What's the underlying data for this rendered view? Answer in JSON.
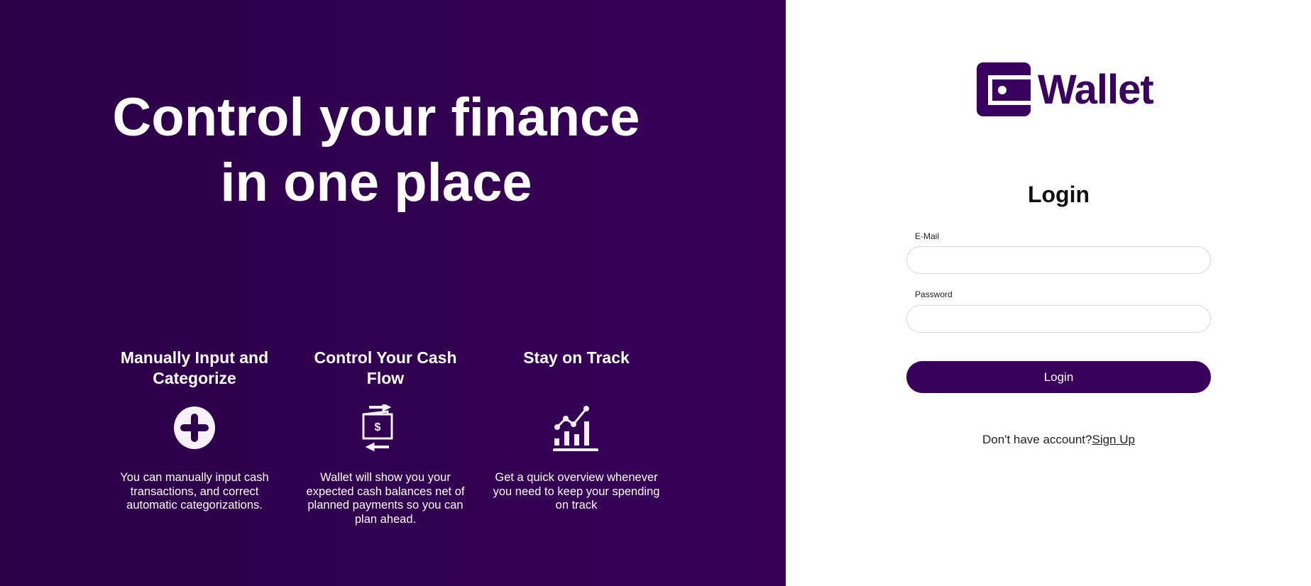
{
  "hero": {
    "headline_line1": "Control your finance",
    "headline_line2": "in one place"
  },
  "features": [
    {
      "title": "Manually Input and Categorize",
      "icon": "plus-circle-icon",
      "description": "You can manually input cash transactions, and correct automatic categorizations."
    },
    {
      "title": "Control Your Cash Flow",
      "icon": "cash-flow-icon",
      "description": "Wallet will show you your expected cash balances net of planned payments so you can plan ahead."
    },
    {
      "title": "Stay on Track",
      "icon": "chart-growth-icon",
      "description": "Get a quick overview whenever you need to keep your spending on track"
    }
  ],
  "brand": {
    "name": "Wallet",
    "color": "#3a0060"
  },
  "login": {
    "title": "Login",
    "email_label": "E-Mail",
    "email_value": "",
    "password_label": "Password",
    "password_value": "",
    "button": "Login",
    "signup_prompt": "Don't have account?",
    "signup_link": "Sign Up"
  }
}
